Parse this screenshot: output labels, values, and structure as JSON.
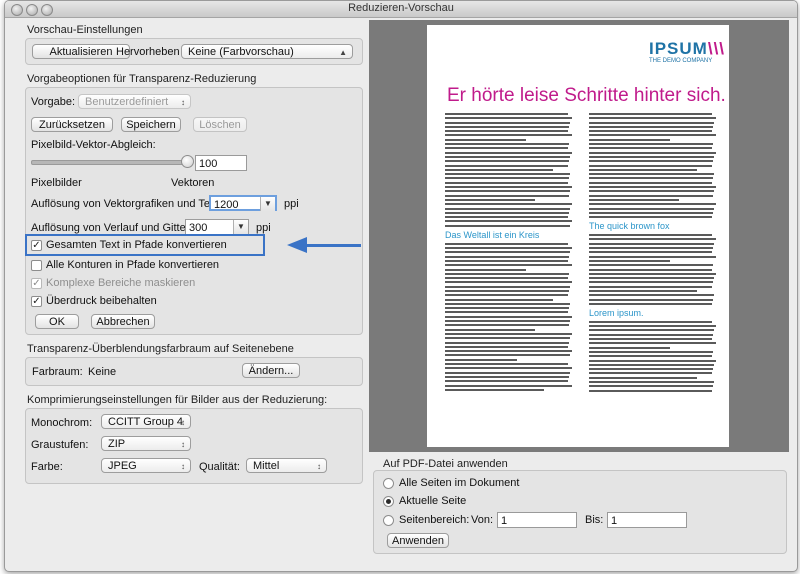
{
  "window": {
    "title": "Reduzieren-Vorschau"
  },
  "preview_settings": {
    "title": "Vorschau-Einstellungen",
    "refresh_button": "Aktualisieren",
    "highlight_label": "Hervorheben",
    "highlight_value": "Keine (Farbvorschau)"
  },
  "preset_options": {
    "title": "Vorgabeoptionen für Transparenz-Reduzierung",
    "preset_label": "Vorgabe:",
    "preset_value": "Benutzerdefiniert",
    "reset_button": "Zurücksetzen",
    "save_button": "Speichern",
    "delete_button": "Löschen",
    "balance_label": "Pixelbild-Vektor-Abgleich:",
    "balance_value": "100",
    "balance_fraction": 1.0,
    "raster_label": "Pixelbilder",
    "vector_label": "Vektoren",
    "vector_res_label": "Auflösung von Vektorgrafiken und Text:",
    "vector_res_value": "1200",
    "gradient_res_label": "Auflösung von Verlauf und Gitter:",
    "gradient_res_value": "300",
    "ppi": "ppi",
    "cb_text_label": "Gesamten Text in Pfade konvertieren",
    "cb_strokes_label": "Alle Konturen in Pfade konvertieren",
    "cb_clip_label": "Komplexe Bereiche maskieren",
    "cb_overprint_label": "Überdruck beibehalten",
    "ok_button": "OK",
    "cancel_button": "Abbrechen"
  },
  "blend_space": {
    "title": "Transparenz-Überblendungsfarbraum auf Seitenebene",
    "label": "Farbraum:",
    "value": "Keine",
    "change_button": "Ändern..."
  },
  "compression": {
    "title": "Komprimierungseinstellungen für Bilder aus der Reduzierung:",
    "mono_label": "Monochrom:",
    "mono_value": "CCITT Group 4",
    "gray_label": "Graustufen:",
    "gray_value": "ZIP",
    "color_label": "Farbe:",
    "color_value": "JPEG",
    "quality_label": "Qualität:",
    "quality_value": "Mittel"
  },
  "apply": {
    "title": "Auf PDF-Datei anwenden",
    "all_pages": "Alle Seiten im Dokument",
    "current_page": "Aktuelle Seite",
    "page_range": "Seitenbereich:",
    "from_label": "Von:",
    "from_value": "1",
    "to_label": "Bis:",
    "to_value": "1",
    "apply_button": "Anwenden"
  },
  "preview": {
    "logo": "IPSUM",
    "logo_bars": "\\\\\\",
    "logo_sub": "THE DEMO COMPANY",
    "headline": "Er hörte leise Schritte hinter sich.",
    "sub1": "Das Weltall ist ein Kreis",
    "sub2": "The quick brown fox",
    "sub3": "Lorem ipsum.",
    "accent": "#c01b8b",
    "subhead_color": "#2b95c9"
  }
}
